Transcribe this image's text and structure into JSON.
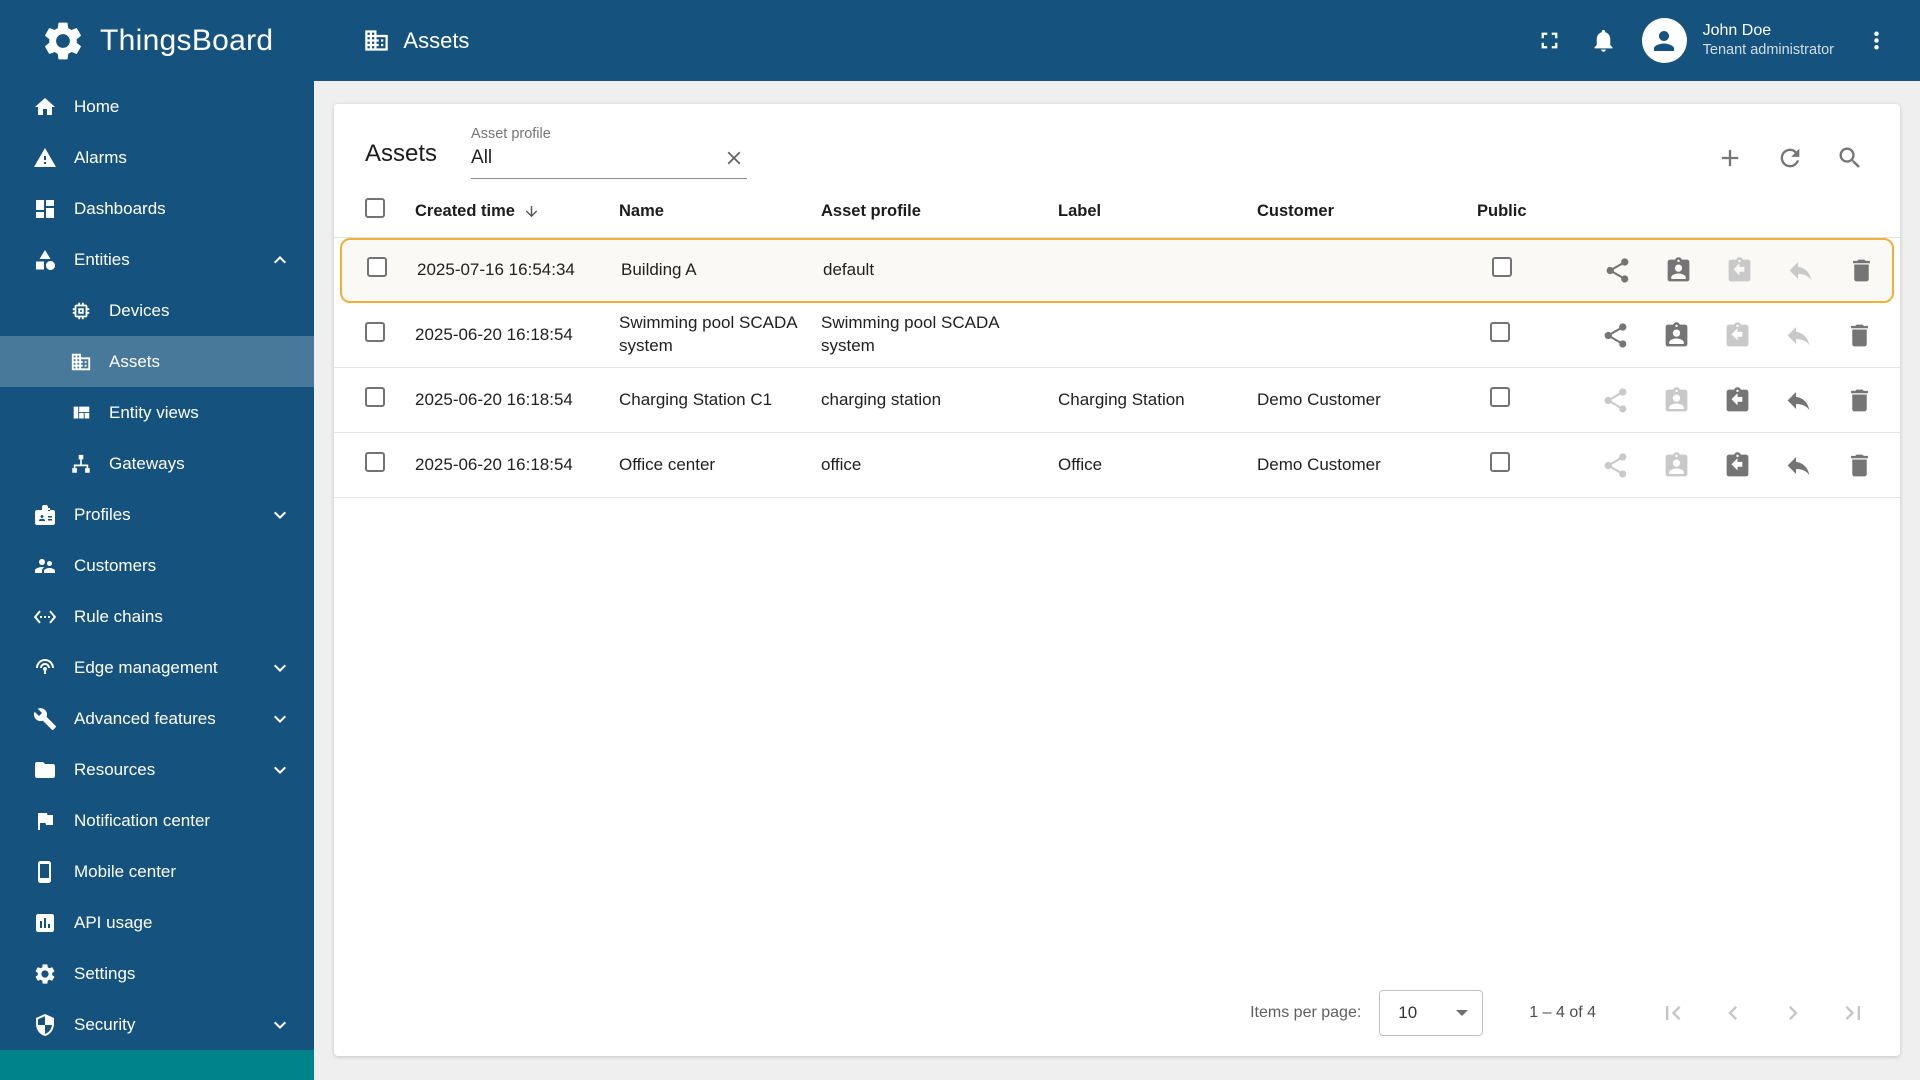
{
  "app": {
    "name": "ThingsBoard"
  },
  "colors": {
    "primary": "#15537E",
    "sidebar_selected": "rgba(255,255,255,0.22)",
    "accent_row_border": "#F0B03C",
    "icon_gray": "#757575",
    "icon_disabled": "#C9C9C9",
    "teal_strip": "#00838A"
  },
  "header": {
    "page_title": "Assets",
    "user": {
      "name": "John Doe",
      "role": "Tenant administrator"
    }
  },
  "sidebar": {
    "items": [
      {
        "label": "Home",
        "icon": "home-icon"
      },
      {
        "label": "Alarms",
        "icon": "warning-icon"
      },
      {
        "label": "Dashboards",
        "icon": "dashboards-icon"
      },
      {
        "label": "Entities",
        "icon": "entities-icon",
        "expanded": true
      },
      {
        "label": "Devices",
        "icon": "devices-icon",
        "child": true
      },
      {
        "label": "Assets",
        "icon": "assets-icon",
        "child": true,
        "selected": true
      },
      {
        "label": "Entity views",
        "icon": "entity-views-icon",
        "child": true
      },
      {
        "label": "Gateways",
        "icon": "gateways-icon",
        "child": true
      },
      {
        "label": "Profiles",
        "icon": "profiles-icon",
        "collapsible": true
      },
      {
        "label": "Customers",
        "icon": "customers-icon"
      },
      {
        "label": "Rule chains",
        "icon": "rule-chains-icon"
      },
      {
        "label": "Edge management",
        "icon": "edge-management-icon",
        "collapsible": true
      },
      {
        "label": "Advanced features",
        "icon": "advanced-features-icon",
        "collapsible": true
      },
      {
        "label": "Resources",
        "icon": "resources-icon",
        "collapsible": true
      },
      {
        "label": "Notification center",
        "icon": "notification-center-icon"
      },
      {
        "label": "Mobile center",
        "icon": "mobile-center-icon"
      },
      {
        "label": "API usage",
        "icon": "api-usage-icon"
      },
      {
        "label": "Settings",
        "icon": "settings-icon"
      },
      {
        "label": "Security",
        "icon": "security-icon",
        "collapsible": true
      }
    ]
  },
  "content": {
    "title": "Assets",
    "filter": {
      "label": "Asset profile",
      "value": "All"
    },
    "table": {
      "columns": [
        "Created time",
        "Name",
        "Asset profile",
        "Label",
        "Customer",
        "Public"
      ],
      "rows": [
        {
          "created_time": "2025-07-16 16:54:34",
          "name": "Building A",
          "asset_profile": "default",
          "label": "",
          "customer": "",
          "public": false,
          "highlighted": true
        },
        {
          "created_time": "2025-06-20 16:18:54",
          "name": "Swimming pool SCADA system",
          "asset_profile": "Swimming pool SCADA system",
          "label": "",
          "customer": "",
          "public": false
        },
        {
          "created_time": "2025-06-20 16:18:54",
          "name": "Charging Station C1",
          "asset_profile": "charging station",
          "label": "Charging Station",
          "customer": "Demo Customer",
          "public": false
        },
        {
          "created_time": "2025-06-20 16:18:54",
          "name": "Office center",
          "asset_profile": "office",
          "label": "Office",
          "customer": "Demo Customer",
          "public": false
        }
      ]
    },
    "paginator": {
      "items_per_page_label": "Items per page:",
      "page_size": "10",
      "range_label": "1 – 4 of 4"
    }
  }
}
